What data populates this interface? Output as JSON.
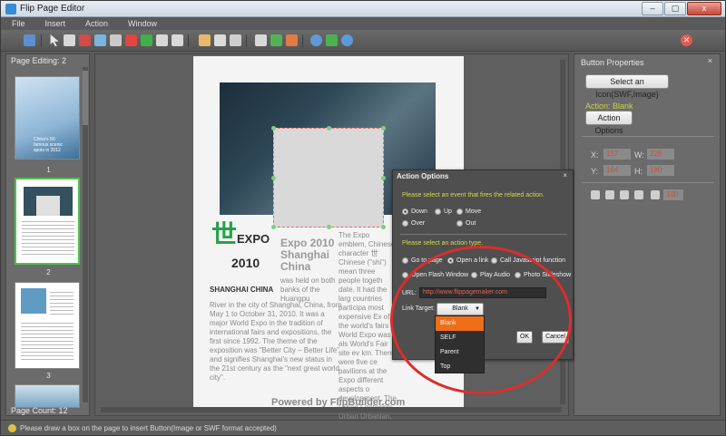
{
  "app": {
    "title": "Flip Page Editor",
    "window_buttons": {
      "minimize": "–",
      "maximize": "▢",
      "close": "x"
    }
  },
  "menu": {
    "items": [
      "File",
      "Insert",
      "Action",
      "Window"
    ]
  },
  "left_panel": {
    "title": "Page Editing: 2",
    "thumbnails": [
      {
        "number": "1",
        "caption": "China's 50 famous scenic spots in 2012"
      },
      {
        "number": "2"
      },
      {
        "number": "3"
      }
    ],
    "page_count": "Page Count: 12"
  },
  "page": {
    "expo_logo_mark": "世",
    "expo_logo_word": "EXPO",
    "expo_logo_year": "2010",
    "expo_subtitle": "SHANGHAI CHINA",
    "heading": "Expo 2010 Shanghai China",
    "heading_tail": "was held on both banks of the Huangpu",
    "body": "River in the city of Shanghai, China, from May 1 to October 31, 2010. It was a major World Expo in the tradition of international fairs and expositions, the first since 1992. The theme of the exposition was \"Better City – Better Life\" and signifies Shanghai's new status in the 21st century as the \"next great world city\".",
    "right_col": "The Expo emblem, Chinese character 世 Chinese (\"shi\") mean three people togeth date. It had the larg countries participa most expensive Ex of the world's fairs World Expo was als World's Fair site ev km. There were five ce pavilions at the Expo different aspects o development. The Urban Footprints, Urban Urbanian, City Being, and Urban Future.",
    "footer": "Powered by FlipBuilder.com"
  },
  "properties": {
    "title": "Button Properties",
    "close": "×",
    "select_icon_button": "Select an Icon(SWF,Image)",
    "action_label": "Action: Blank",
    "action_options_button": "Action Options",
    "x_label": "X:",
    "x_value": "157",
    "w_label": "W:",
    "w_value": "226",
    "y_label": "Y:",
    "y_value": "164",
    "h_label": "H:",
    "h_value": "180",
    "opacity_value": "100"
  },
  "dialog": {
    "title": "Action Options",
    "close": "×",
    "event_hint": "Please select an event that fires the related action.",
    "events": [
      {
        "label": "Down",
        "selected": true
      },
      {
        "label": "Up",
        "selected": false
      },
      {
        "label": "Move",
        "selected": false
      },
      {
        "label": "Over",
        "selected": false
      },
      {
        "label": "Out",
        "selected": false
      }
    ],
    "action_hint": "Please select an action type.",
    "actions": [
      {
        "label": "Go to page",
        "selected": false
      },
      {
        "label": "Open a link",
        "selected": true
      },
      {
        "label": "Call Javascript function",
        "selected": false
      },
      {
        "label": "Open Flash Window",
        "selected": false
      },
      {
        "label": "Play Audio",
        "selected": false
      },
      {
        "label": "Photo Slideshow",
        "selected": false
      }
    ],
    "url_label": "URL:",
    "url_value": "http://www.flippagemaker.com",
    "link_target_label": "Link Target:",
    "link_target_value": "Blank",
    "link_target_options": [
      "Blank",
      "SELF",
      "Parent",
      "Top"
    ],
    "ok": "OK",
    "cancel": "Cancel"
  },
  "status": {
    "text": "Please draw a box on the page to insert Button(Image or SWF format accepted)"
  },
  "colors": {
    "accent_orange": "#ef6f19",
    "highlight_red": "#dc2d2d",
    "hint_yellow": "#d8d848",
    "expo_green": "#27a24b"
  }
}
